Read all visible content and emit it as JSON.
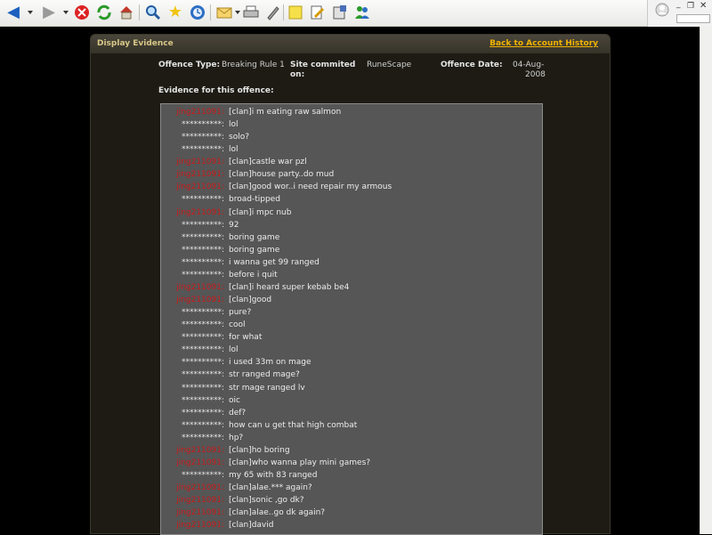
{
  "browser": {
    "toolbar_icons": [
      "back-arrow-icon",
      "forward-arrow-icon",
      "stop-icon",
      "refresh-icon",
      "home-icon",
      "search-icon",
      "favorites-star-icon",
      "history-icon",
      "mail-icon",
      "print-icon",
      "edit-icon",
      "note-icon",
      "research-icon",
      "tools-icon",
      "messenger-icon"
    ],
    "window_buttons": [
      "minimize",
      "restore",
      "close"
    ]
  },
  "panel": {
    "title": "Display Evidence",
    "back_link": "Back to Account History"
  },
  "offence": {
    "type_label": "Offence Type:",
    "type_value": "Breaking Rule 1",
    "site_label_line1": "Site commited",
    "site_label_line2": "on:",
    "site_value": "RuneScape",
    "date_label": "Offence Date:",
    "date_value_line1": "04-Aug-",
    "date_value_line2": "2008",
    "evidence_label": "Evidence for this offence:"
  },
  "chat": [
    {
      "name": "jing211091:",
      "msg": "[clan]i m eating raw salmon"
    },
    {
      "name": "**********:",
      "msg": "lol"
    },
    {
      "name": "**********:",
      "msg": "solo?"
    },
    {
      "name": "**********:",
      "msg": "lol"
    },
    {
      "name": "jing211091:",
      "msg": "[clan]castle war pzl"
    },
    {
      "name": "jing211091:",
      "msg": "[clan]house party..do mud"
    },
    {
      "name": "jing211091:",
      "msg": "[clan]good wor..i need repair my armous"
    },
    {
      "name": "**********:",
      "msg": "broad-tipped"
    },
    {
      "name": "jing211091:",
      "msg": "[clan]i mpc nub"
    },
    {
      "name": "**********:",
      "msg": "92"
    },
    {
      "name": "**********:",
      "msg": "boring game"
    },
    {
      "name": "**********:",
      "msg": "boring game"
    },
    {
      "name": "**********:",
      "msg": "i wanna get 99 ranged"
    },
    {
      "name": "**********:",
      "msg": "before i quit"
    },
    {
      "name": "jing211091:",
      "msg": "[clan]i heard super kebab be4"
    },
    {
      "name": "jing211091:",
      "msg": "[clan]good"
    },
    {
      "name": "**********:",
      "msg": "pure?"
    },
    {
      "name": "**********:",
      "msg": "cool"
    },
    {
      "name": "**********:",
      "msg": "for what"
    },
    {
      "name": "**********:",
      "msg": "lol"
    },
    {
      "name": "**********:",
      "msg": "i used 33m on mage"
    },
    {
      "name": "**********:",
      "msg": "str ranged mage?"
    },
    {
      "name": "**********:",
      "msg": "str mage ranged lv"
    },
    {
      "name": "**********:",
      "msg": "oic"
    },
    {
      "name": "**********:",
      "msg": "def?"
    },
    {
      "name": "**********:",
      "msg": "how can u get that high combat"
    },
    {
      "name": "**********:",
      "msg": "hp?"
    },
    {
      "name": "jing211091:",
      "msg": "[clan]ho boring"
    },
    {
      "name": "jing211091:",
      "msg": "[clan]who wanna play mini games?"
    },
    {
      "name": "**********:",
      "msg": "my 65 with 83 ranged"
    },
    {
      "name": "jing211091:",
      "msg": "[clan]alae.*** again?"
    },
    {
      "name": "jing211091:",
      "msg": "[clan]sonic ,go dk?"
    },
    {
      "name": "jing211091:",
      "msg": "[clan]alae..go dk again?"
    },
    {
      "name": "jing211091:",
      "msg": "[clan]david"
    }
  ]
}
